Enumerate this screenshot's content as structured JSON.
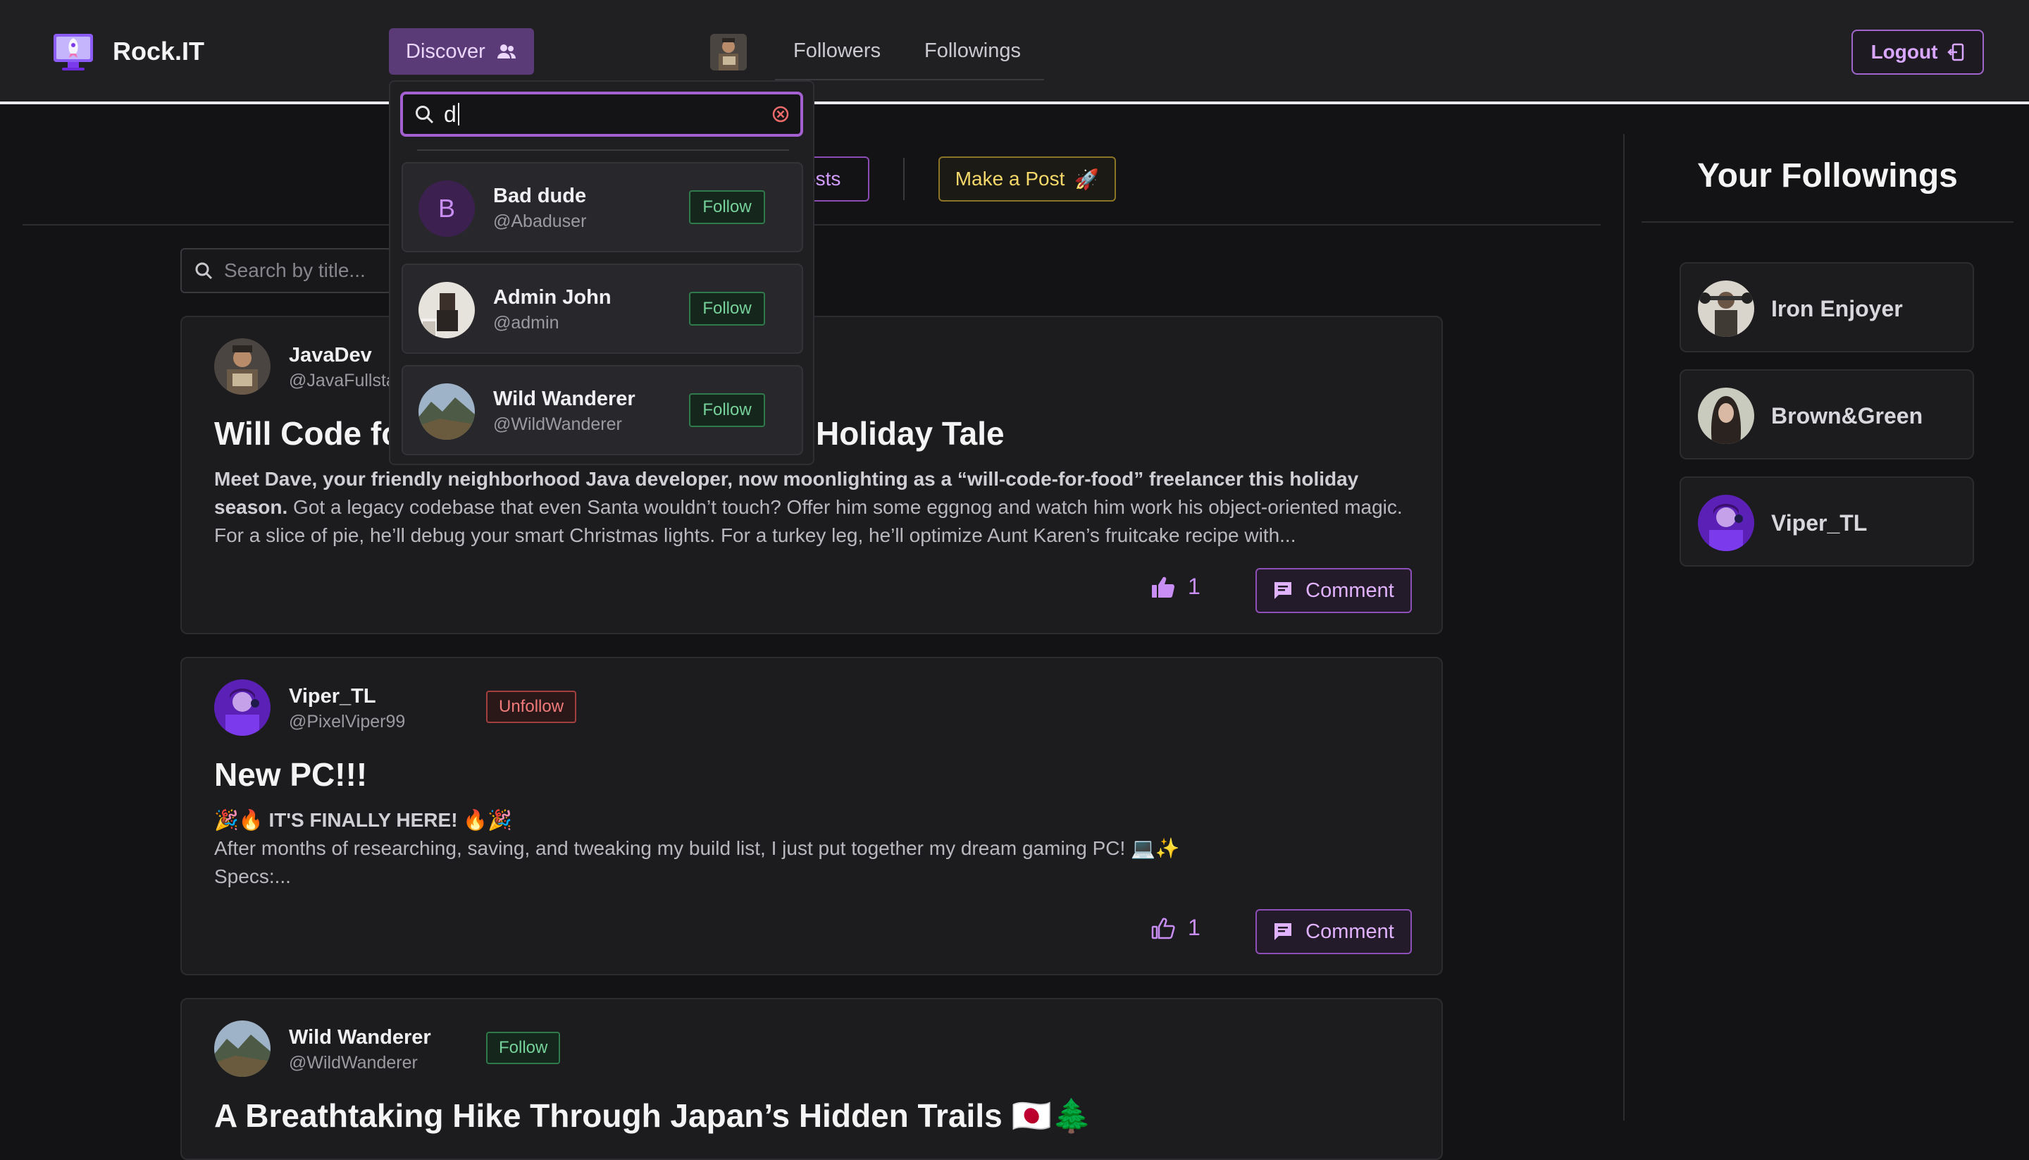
{
  "app": {
    "name": "Rock.IT"
  },
  "nav": {
    "discover_label": "Discover",
    "followers_label": "Followers",
    "followings_label": "Followings",
    "logout_label": "Logout"
  },
  "toolbar": {
    "posts_tab_label": "osts",
    "make_post_label": "Make a Post",
    "make_post_emoji": "🚀",
    "search_placeholder": "Search by title..."
  },
  "discover_dropdown": {
    "query": "d",
    "results": [
      {
        "name": "Bad dude",
        "handle": "@Abaduser",
        "initial": "B",
        "action": "Follow"
      },
      {
        "name": "Admin John",
        "handle": "@admin",
        "action": "Follow"
      },
      {
        "name": "Wild Wanderer",
        "handle": "@WildWanderer",
        "action": "Follow"
      }
    ]
  },
  "posts": [
    {
      "author": "JavaDev",
      "handle": "@JavaFullsta",
      "title_left": "Will Code fo",
      "title_right": "Holiday Tale",
      "body_bold": "Meet Dave, your friendly neighborhood Java developer, now moonlighting as a “will-code-for-food” freelancer this holiday season.",
      "body_rest": " Got a legacy codebase that even Santa wouldn’t touch? Offer him some eggnog and watch him work his object-oriented magic. For a slice of pie, he’ll debug your smart Christmas lights. For a turkey leg, he’ll optimize Aunt Karen’s fruitcake recipe with...",
      "likes": "1",
      "comment_label": "Comment"
    },
    {
      "author": "Viper_TL",
      "handle": "@PixelViper99",
      "badge": "Unfollow",
      "title": "New PC!!!",
      "line1": "🎉🔥 IT'S FINALLY HERE! 🔥🎉",
      "line2": "After months of researching, saving, and tweaking my build list, I just put together my dream gaming PC! 💻✨",
      "line3": "Specs:...",
      "likes": "1",
      "comment_label": "Comment"
    },
    {
      "author": "Wild Wanderer",
      "handle": "@WildWanderer",
      "badge": "Follow",
      "title": "A Breathtaking Hike Through Japan’s Hidden Trails 🇯🇵🌲"
    }
  ],
  "sidebar": {
    "title": "Your Followings",
    "items": [
      {
        "name": "Iron Enjoyer"
      },
      {
        "name": "Brown&Green"
      },
      {
        "name": "Viper_TL"
      }
    ]
  },
  "colors": {
    "accent_purple": "#a45fd1",
    "follow_green": "#76d29a",
    "unfollow_red": "#f07a7a",
    "make_post_yellow": "#f3d76a",
    "background": "#131315"
  }
}
